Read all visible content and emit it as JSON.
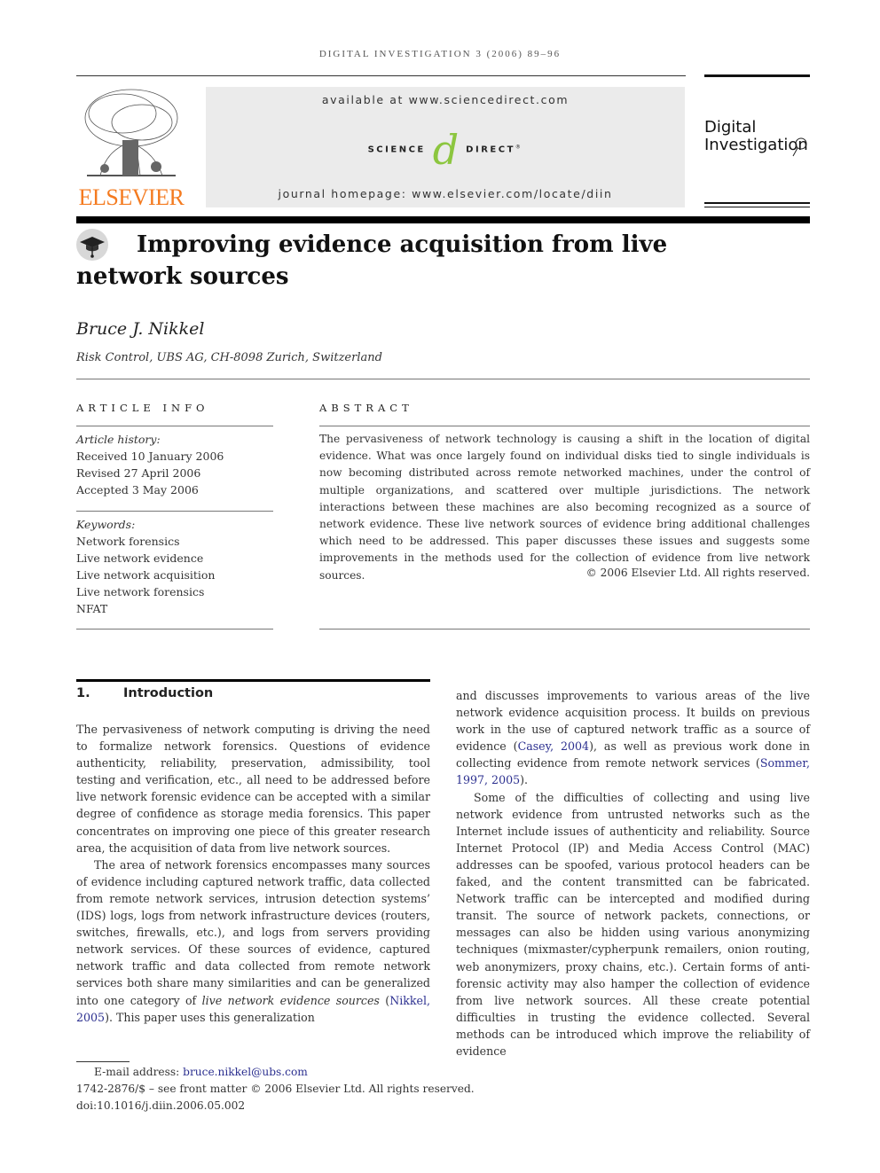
{
  "header": {
    "running_head": "DIGITAL INVESTIGATION 3 (2006) 89–96",
    "publisher_logo": "ELSEVIER",
    "sciencedirect": {
      "available": "available at www.sciencedirect.com",
      "logo_left": "SCIENCE",
      "logo_at": "d",
      "logo_right": "DIRECT",
      "registered": "®",
      "homepage": "journal homepage: www.elsevier.com/locate/diin"
    },
    "journal_logo": {
      "line1": "Digital",
      "line2": "Investigation"
    },
    "colors": {
      "elsevier_orange": "#f47b20",
      "sd_green": "#8cc63f",
      "sd_box_bg": "#ebebeb",
      "link_blue": "#2b2f8f"
    }
  },
  "article": {
    "title": "Improving evidence acquisition from live network sources",
    "author": "Bruce J. Nikkel",
    "affiliation": "Risk Control, UBS AG, CH-8098 Zurich, Switzerland"
  },
  "article_info": {
    "label": "ARTICLE INFO",
    "history_label": "Article history:",
    "history": [
      "Received 10 January 2006",
      "Revised 27 April 2006",
      "Accepted 3 May 2006"
    ],
    "keywords_label": "Keywords:",
    "keywords": [
      "Network forensics",
      "Live network evidence",
      "Live network acquisition",
      "Live network forensics",
      "NFAT"
    ]
  },
  "abstract": {
    "label": "ABSTRACT",
    "text": "The pervasiveness of network technology is causing a shift in the location of digital evidence. What was once largely found on individual disks tied to single individuals is now becoming distributed across remote networked machines, under the control of multiple organizations, and scattered over multiple jurisdictions. The network interactions between these machines are also becoming recognized as a source of network evidence. These live network sources of evidence bring additional challenges which need to be addressed. This paper discusses these issues and suggests some improvements in the methods used for the collection of evidence from live network sources.",
    "copyright": "© 2006 Elsevier Ltd. All rights reserved."
  },
  "body": {
    "section_number": "1.",
    "section_title": "Introduction",
    "left": {
      "p1": "The pervasiveness of network computing is driving the need to formalize network forensics. Questions of evidence authenticity, reliability, preservation, admissibility, tool testing and verification, etc., all need to be addressed before live network forensic evidence can be accepted with a similar degree of confidence as storage media forensics. This paper concentrates on improving one piece of this greater research area, the acquisition of data from live network sources.",
      "p2_a": "The area of network forensics encompasses many sources of evidence including captured network traffic, data collected from remote network services, intrusion detection systems’ (IDS) logs, logs from network infrastructure devices (routers, switches, firewalls, etc.), and logs from servers providing network services. Of these sources of evidence, captured network traffic and data collected from remote network services both share many similarities and can be generalized into one category of ",
      "p2_italic": "live network evidence sources",
      "p2_b": " (",
      "p2_cite": "Nikkel, 2005",
      "p2_c": "). This paper uses this generalization"
    },
    "right": {
      "p1_a": "and discusses improvements to various areas of the live network evidence acquisition process. It builds on previous work in the use of captured network traffic as a source of evidence (",
      "p1_cite1": "Casey, 2004",
      "p1_b": "), as well as previous work done in collecting evidence from remote network services (",
      "p1_cite2": "Sommer, 1997, 2005",
      "p1_c": ").",
      "p2": "Some of the difficulties of collecting and using live network evidence from untrusted networks such as the Internet include issues of authenticity and reliability. Source Internet Protocol (IP) and Media Access Control (MAC) addresses can be spoofed, various protocol headers can be faked, and the content transmitted can be fabricated. Network traffic can be intercepted and modified during transit. The source of network packets, connections, or messages can also be hidden using various anonymizing techniques (mixmaster/cypherpunk remailers, onion routing, web anonymizers, proxy chains, etc.). Certain forms of anti-forensic activity may also hamper the collection of evidence from live network sources. All these create potential difficulties in trusting the evidence collected. Several methods can be introduced which improve the reliability of evidence"
    }
  },
  "footnotes": {
    "email_label": "E-mail address: ",
    "email": "bruce.nikkel@ubs.com",
    "front_matter": "1742-2876/$ – see front matter © 2006 Elsevier Ltd. All rights reserved.",
    "doi": "doi:10.1016/j.diin.2006.05.002"
  }
}
